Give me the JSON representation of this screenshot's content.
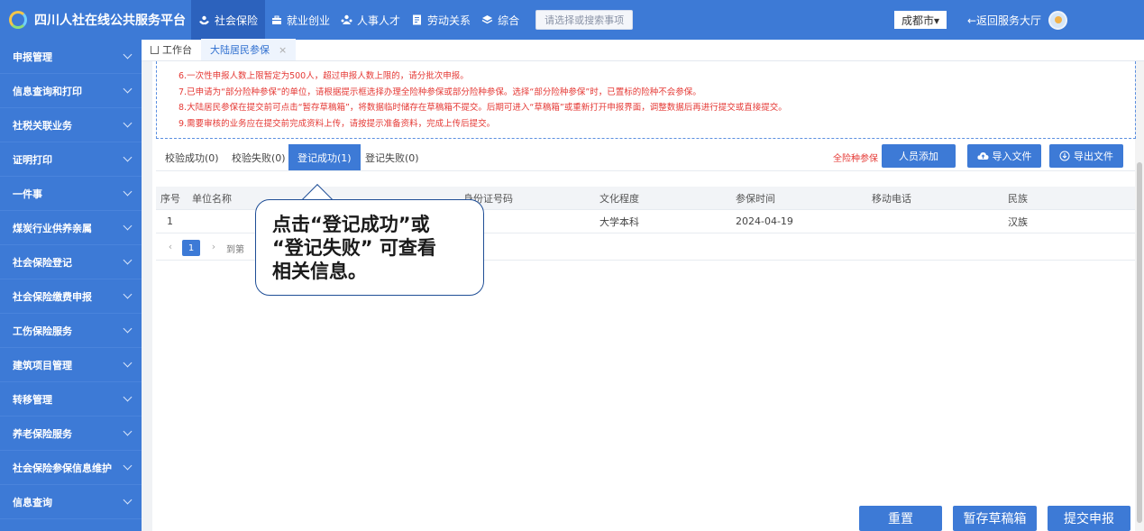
{
  "header": {
    "app_title": "四川人社在线公共服务平台",
    "nav": [
      {
        "label": "社会保险",
        "icon": "hands-icon",
        "active": true
      },
      {
        "label": "就业创业",
        "icon": "briefcase-icon"
      },
      {
        "label": "人事人才",
        "icon": "people-icon"
      },
      {
        "label": "劳动关系",
        "icon": "document-icon"
      },
      {
        "label": "综合",
        "icon": "layers-icon"
      }
    ],
    "search_placeholder": "请选择或搜索事项",
    "city": "成都市▾",
    "back_label": "←返回服务大厅"
  },
  "sidebar": {
    "items": [
      {
        "label": "申报管理"
      },
      {
        "label": "信息查询和打印"
      },
      {
        "label": "社税关联业务"
      },
      {
        "label": "证明打印"
      },
      {
        "label": "一件事"
      },
      {
        "label": "煤炭行业供养亲属"
      },
      {
        "label": "社会保险登记"
      },
      {
        "label": "社会保险缴费申报"
      },
      {
        "label": "工伤保险服务"
      },
      {
        "label": "建筑项目管理"
      },
      {
        "label": "转移管理"
      },
      {
        "label": "养老保险服务"
      },
      {
        "label": "社会保险参保信息维护"
      },
      {
        "label": "信息查询"
      }
    ]
  },
  "page_tabs": {
    "home": "工作台",
    "current": "大陆居民参保",
    "close": "×"
  },
  "notice": {
    "lines": [
      "6.一次性申报人数上限暂定为500人，超过申报人数上限的，请分批次申报。",
      "7.已申请为“部分险种参保”的单位，请根据提示框选择办理全险种参保或部分险种参保。选择“部分险种参保”时，已置标的险种不会参保。",
      "8.大陆居民参保在提交前可点击“暂存草稿箱”，将数据临时储存在草稿箱不提交。后期可进入“草稿箱”或重新打开申报界面，调整数据后再进行提交或直接提交。",
      "9.需要审核的业务应在提交前完成资料上传，请按提示准备资料，完成上传后提交。"
    ]
  },
  "subtabs": [
    {
      "label": "校验成功(0)"
    },
    {
      "label": "校验失败(0)"
    },
    {
      "label": "登记成功(1)",
      "active": true
    },
    {
      "label": "登记失败(0)"
    }
  ],
  "actions": {
    "risk_label": "全险种参保",
    "add_person": "人员添加",
    "import_file": "导入文件",
    "export_file": "导出文件"
  },
  "table": {
    "headers": [
      "序号",
      "单位名称",
      "身份证号码",
      "文化程度",
      "参保时间",
      "移动电话",
      "民族"
    ],
    "rows": [
      {
        "index": "1",
        "unit": "",
        "id": "",
        "education": "大学本科",
        "date": "2024-04-19",
        "phone": "",
        "ethnicity": "汉族"
      }
    ]
  },
  "pager": {
    "prev": "‹",
    "current": "1",
    "next": "›",
    "goto": "到第"
  },
  "callout": {
    "text_line1": "点击“登记成功”或",
    "text_line2": "“登记失败” 可查看",
    "text_line3": "相关信息。"
  },
  "footer": {
    "reset": "重置",
    "save_draft": "暂存草稿箱",
    "submit": "提交申报"
  },
  "colors": {
    "primary": "#3d7ad6",
    "warning_text": "#e53935"
  }
}
